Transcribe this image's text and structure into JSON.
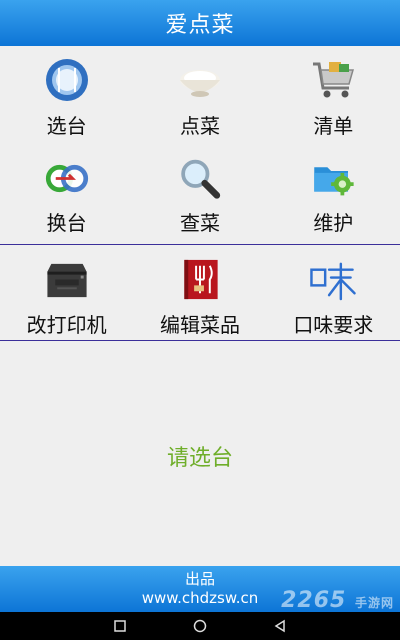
{
  "header": {
    "title": "爱点菜"
  },
  "menu": {
    "row1": [
      {
        "label": "选台",
        "icon": "plate-icon"
      },
      {
        "label": "点菜",
        "icon": "rice-bowl-icon"
      },
      {
        "label": "清单",
        "icon": "shopping-cart-icon"
      }
    ],
    "row2": [
      {
        "label": "换台",
        "icon": "swap-circles-icon"
      },
      {
        "label": "查菜",
        "icon": "magnifier-icon"
      },
      {
        "label": "维护",
        "icon": "folder-gear-icon"
      }
    ],
    "row3": [
      {
        "label": "改打印机",
        "icon": "printer-icon"
      },
      {
        "label": "编辑菜品",
        "icon": "menu-book-icon"
      },
      {
        "label": "口味要求",
        "icon": "taste-char-icon"
      }
    ]
  },
  "status_text": "请选台",
  "footer": {
    "line1": "出品",
    "line2": "www.chdzsw.cn"
  },
  "watermark": {
    "number": "2265",
    "text": "手游网"
  },
  "colors": {
    "header_blue": "#0d75d6",
    "status_green": "#6fae2a",
    "divider": "#3b2f9a"
  }
}
